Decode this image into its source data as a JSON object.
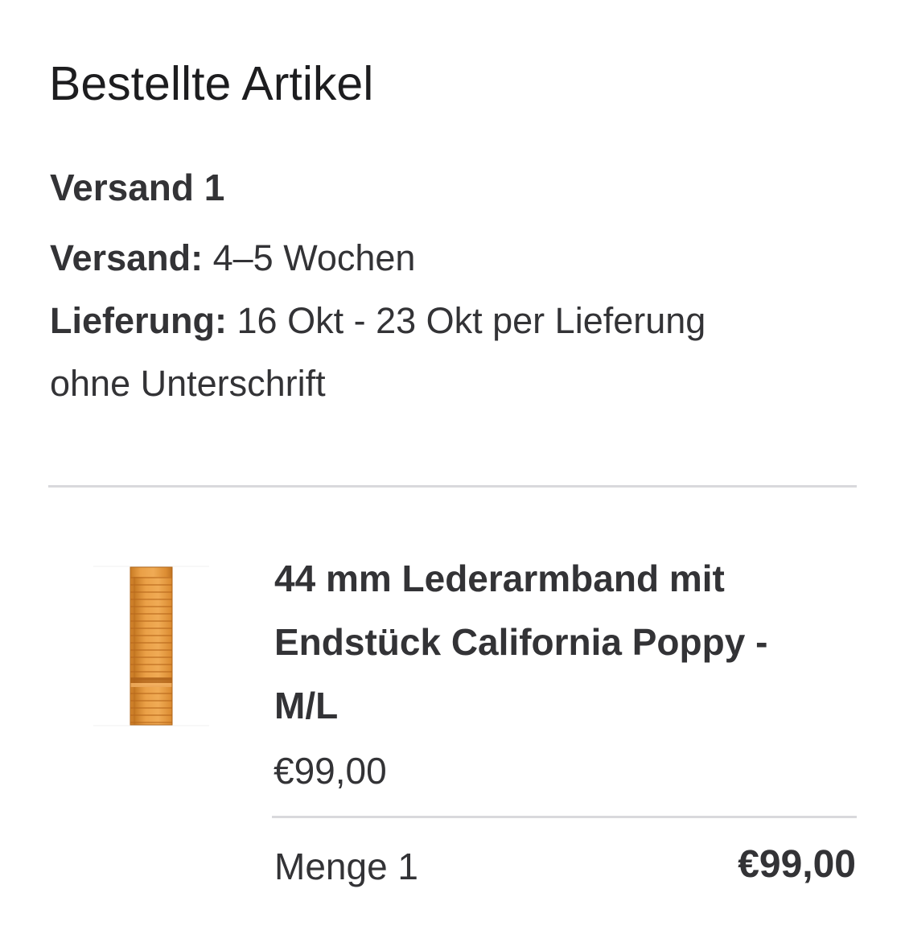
{
  "order": {
    "section_title": "Bestellte Artikel",
    "shipment": {
      "title": "Versand 1",
      "shipping_label": "Versand:",
      "shipping_value": "4–5 Wochen",
      "delivery_label": "Lieferung:",
      "delivery_value_line1": "16 Okt - 23 Okt per Lieferung",
      "delivery_value_line2": "ohne Unterschrift"
    },
    "item": {
      "image_icon": "leather-link-band-image",
      "image_color": "#e59a3c",
      "name_line1": "44 mm Lederarmband mit",
      "name_line2": "Endstück California Poppy -",
      "name_line3": "M/L",
      "unit_price": "€99,00",
      "quantity_label": "Menge 1",
      "line_total": "€99,00"
    }
  }
}
